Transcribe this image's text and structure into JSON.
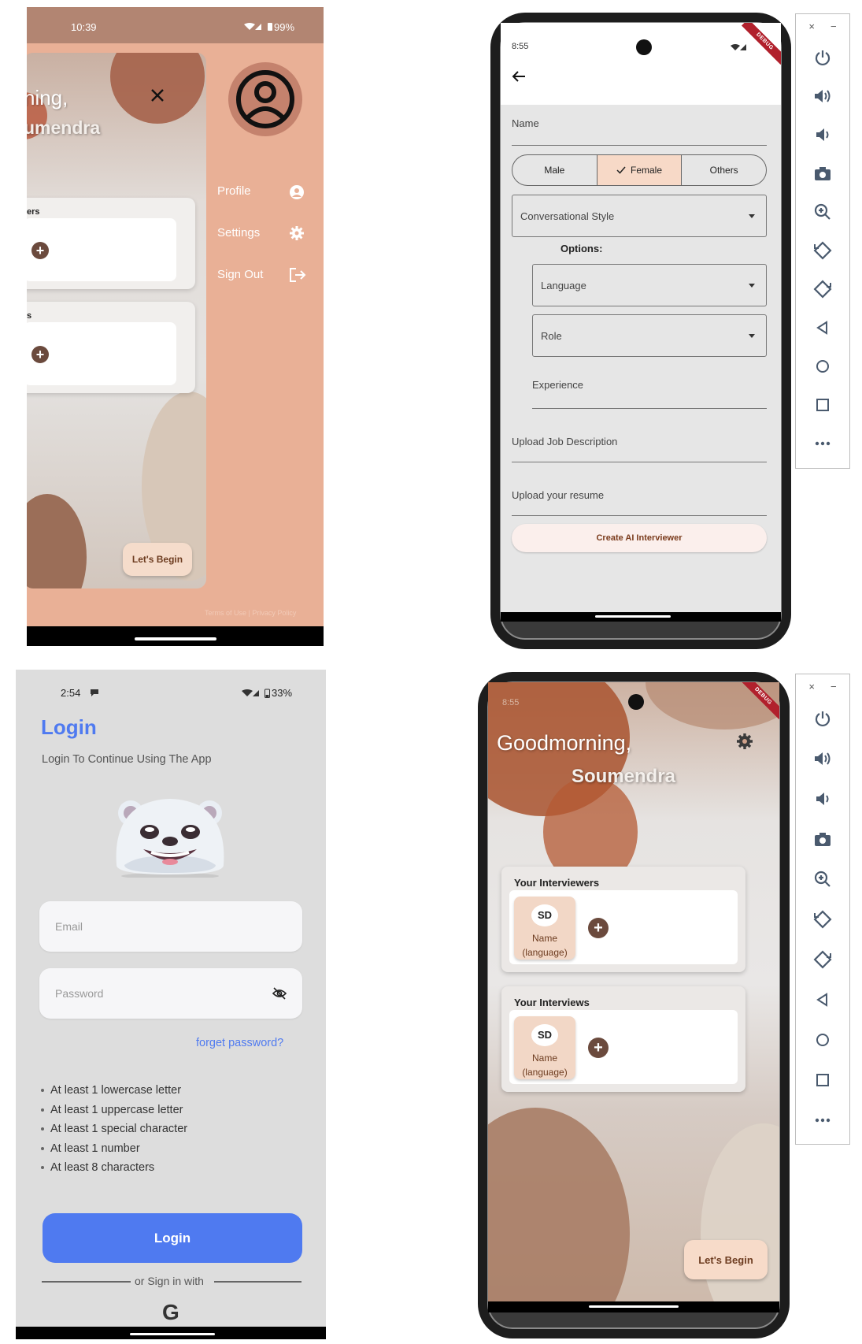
{
  "drawer_screen": {
    "status_time": "10:39",
    "status_battery": "99%",
    "greeting_fragment": "ning,",
    "name_fragment": "umendra",
    "section1_fragment": "ers",
    "section2_fragment": "s",
    "menu": [
      {
        "label": "Profile",
        "icon": "account-circle-icon"
      },
      {
        "label": "Settings",
        "icon": "gear-icon"
      },
      {
        "label": "Sign Out",
        "icon": "logout-icon"
      }
    ],
    "lets_begin": "Let's Begin",
    "footer": "Terms of Use | Privacy Policy"
  },
  "form_screen": {
    "status_time": "8:55",
    "debug": "DEBUG",
    "name_label": "Name",
    "gender": {
      "options": [
        "Male",
        "Female",
        "Others"
      ],
      "selected": "Female"
    },
    "conversational_style": "Conversational Style",
    "options_label": "Options:",
    "language": "Language",
    "role": "Role",
    "experience": "Experience",
    "upload_jd": "Upload Job Description",
    "upload_resume": "Upload your resume",
    "create_button": "Create AI Interviewer"
  },
  "login_screen": {
    "status_time": "2:54",
    "status_battery": "33%",
    "title": "Login",
    "subtitle": "Login To Continue Using The App",
    "email_placeholder": "Email",
    "password_placeholder": "Password",
    "forget_password": "forget password?",
    "rules": [
      "At least 1 lowercase letter",
      "At least 1 uppercase letter",
      "At least 1 special character",
      "At least 1 number",
      "At least 8 characters"
    ],
    "login_button": "Login",
    "or_sign_in": "or Sign in with",
    "google_letter": "G",
    "accent_color": "#4f7af0"
  },
  "home_screen": {
    "status_time": "8:55",
    "debug": "DEBUG",
    "greeting": "Goodmorning,",
    "user_name": "Soumendra",
    "interviewers_title": "Your Interviewers",
    "interviews_title": "Your Interviews",
    "tile": {
      "initials": "SD",
      "name": "Name",
      "language": "(language)"
    },
    "lets_begin": "Let's Begin"
  },
  "emulator_toolbar": {
    "close": "×",
    "minimize": "−",
    "tools": [
      "power-icon",
      "volume-up-icon",
      "volume-down-icon",
      "camera-icon",
      "zoom-icon",
      "rotate-left-icon",
      "rotate-right-icon",
      "back-icon",
      "home-icon",
      "overview-icon",
      "more-icon"
    ]
  }
}
